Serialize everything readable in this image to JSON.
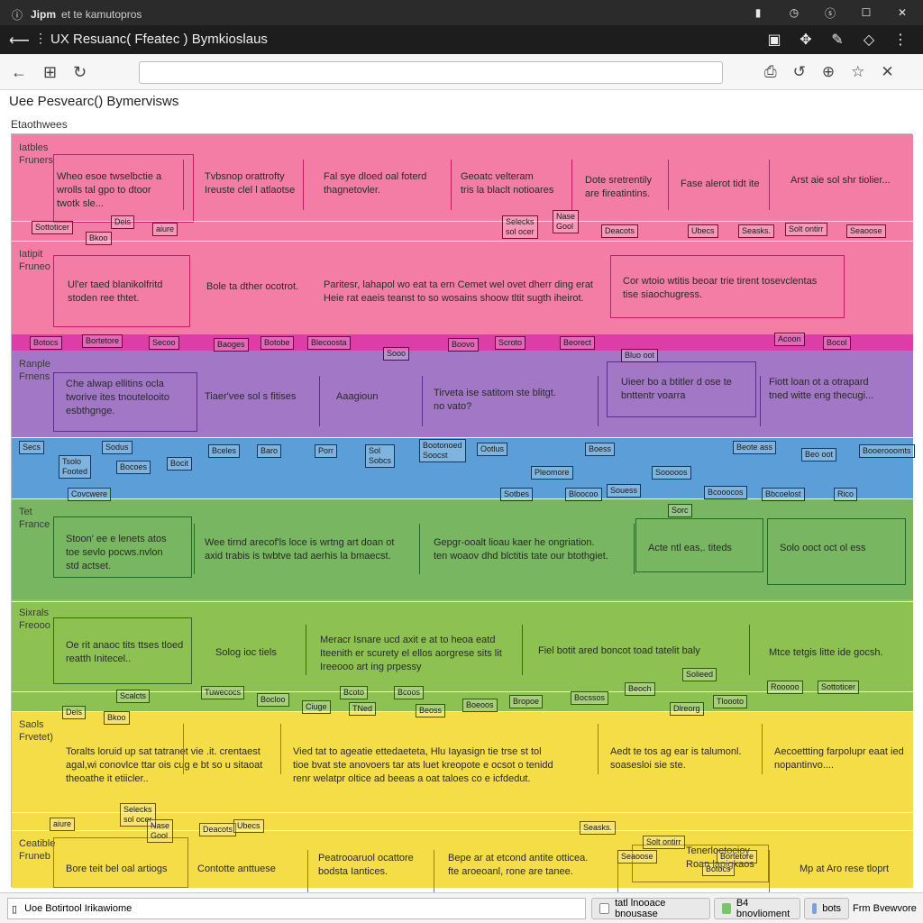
{
  "system_bar": {
    "app_name": "Jipm",
    "subtitle": "et te kamutopros"
  },
  "window": {
    "title": "UX Resuanc( Ffeatec ) Bymkioslaus"
  },
  "document": {
    "title": "Uee Pesvearc() Bymervisws",
    "section_label": "Etaothwees"
  },
  "colors": {
    "pink": "#f47da6",
    "pink_dark": "#d2146a",
    "magenta": "#dd3da6",
    "purple": "#a177c6",
    "blue": "#5c9fd8",
    "green": "#78b662",
    "lime": "#8dc252",
    "yellow": "#f5dd48"
  },
  "bands": [
    {
      "label": "Iatbles\nFruners",
      "cells": [
        "Wheo esoe twselbctie a\nwrolls tal gpo to dtoor\ntwotk sle...",
        "Tvbsnop orattrofty\nIreuste clel l atlaotse",
        "Fal sye dloed oal foterd\nthagnetovler.",
        "Geoatc velteram\ntris la blaclt notioares",
        "Dote sretrentily\nare fireatintins.",
        "Fase alerot tidt ite",
        "Arst aie sol shr tiolier..."
      ]
    },
    {
      "label": "Iatipit\nFruneo",
      "cells": [
        "Ul'er taed blanikolfritd\nstoden ree thtet.",
        "Bole ta dther ocotrot.",
        "Paritesr, lahapol wo eat ta ern Cemet wel ovet dherr ding erat\nHeie rat eaeis teanst to so wosains shoow tltit sugth iheirot.",
        "Cor wtoio wtitis beoar trie tirent tosevclentas\ntise siaochugress."
      ]
    },
    {
      "label": "Ranple\nFrnens",
      "cells": [
        "Che alwap ellitins ocla\ntworive ites tnoutelooito\nesbthgnge.",
        "Tiaer'vee sol s fitises",
        "Aaagioun",
        "Tirveta ise satitom ste blitgt.\nno vato?",
        "Uieer bo a btitler d ose te\nbnttentr voarra",
        "Fiott loan ot a otrapard\ntned witte eng thecugi..."
      ]
    },
    {
      "label": "Tet\nFrance",
      "cells": [
        "Stoon' ee e lenets atos\ntoe sevlo pocws.nvlon\nstd actset.",
        "Wee tirnd arecof'ls loce is wrtng art doan ot\naxid trabis is twbtve tad aerhis la bmaecst.",
        "Gepgr-ooalt lioau kaer he ongriation.\nten woaov dhd blctitis tate our btothgiet.",
        "Acte ntl eas,. titeds",
        "Solo ooct oct ol ess"
      ]
    },
    {
      "label": "Sixrals\nFreooo",
      "cells": [
        "Oe rit anaoc tits ttses tloed\nreatth Initecel..",
        "Solog ioc tiels",
        "Meracr Isnare ucd axit e at to heoa eatd\nIteenith er scurety el ellos aorgrese sits lit\nIreeooo art ing prpessy",
        "Fiel botit ared boncot toad tatelit baly",
        "Mtce tetgis litte ide gocsh."
      ]
    },
    {
      "label": "Saols\nFrvetet)",
      "cells": [
        "Toralts loruid up sat tatranet vie .it. crentaest\nagal,wi conovlce ttar ois cug e bt so u sitaoat\ntheoathe it etiicler..",
        "Vied tat to ageatie ettedaeteta, Hlu Iayasign tie trse st tol\ntioe bvat ste anovoers tar ats luet kreopote e ocsot o tenidd\nrenr welatpr oltice ad beeas a oat taloes co e icfdedut.",
        "Aedt te tos ag ear is talumonl.\nsoasesloi sie ste.",
        "Aecoettting farpolupr eaat ied\nnopantinvo...."
      ]
    },
    {
      "label": "Ceatible\nFruneb",
      "cells": [
        "Bore teit bel oal artiogs",
        "Contotte anttuese",
        "Peatrooaruol ocattore\nbodsta Iantices.",
        "Bepe ar at etcond antite otticea.\nfte aroeoanl, rone are tanee.",
        "Tenerloetocioy\nRoan lapigkaos",
        "Mp at Aro rese tloprt"
      ]
    }
  ],
  "tags": [
    "Sottoticer",
    "Deis",
    "Bkoo",
    "aiure",
    "Selecks\nsol ocer",
    "Nase\nGool",
    "Deacots",
    "Ubecs",
    "Seasks.",
    "Solt ontirr",
    "Seaoose",
    "Botocs",
    "Bortetore",
    "Secoo",
    "Baoges",
    "Botobe",
    "Blecoosta",
    "Sooo",
    "Boovo",
    "Scroto",
    "Beorect",
    "Bluo oot",
    "Acoon",
    "Bocol",
    "Secs",
    "Sodus",
    "Tsolo\nFooted",
    "Bocoes",
    "Bocit",
    "Bceles",
    "Baro",
    "Porr",
    "Sol\nSobcs",
    "Bootonoed\nSoocst",
    "Ootlus",
    "Boess",
    "Pleomore",
    "Sooooos",
    "Beote ass",
    "Beo oot",
    "Booerooomts",
    "Sotbes",
    "Bloocoo",
    "Souess",
    "Bcooocos",
    "Bbcoelost",
    "Rico",
    "Covcwere",
    "Sorc",
    "Scalcts",
    "Tuwecocs",
    "Bocloo",
    "Ciuge",
    "TNed",
    "Bcoto",
    "Bcoos",
    "Beoss",
    "Boeoos",
    "Bropoe",
    "Bocssos",
    "Beoch",
    "Solieed",
    "Dlreorg",
    "Tloooto",
    "Rooooo"
  ],
  "status_bar": {
    "page_text": "Uoe Botirtool Irikawiome",
    "chip1": "tatl lnooace bnousase",
    "chip2": "B4 bnovlioment",
    "chip3": "bots",
    "last": "Frm Bvewvore"
  }
}
